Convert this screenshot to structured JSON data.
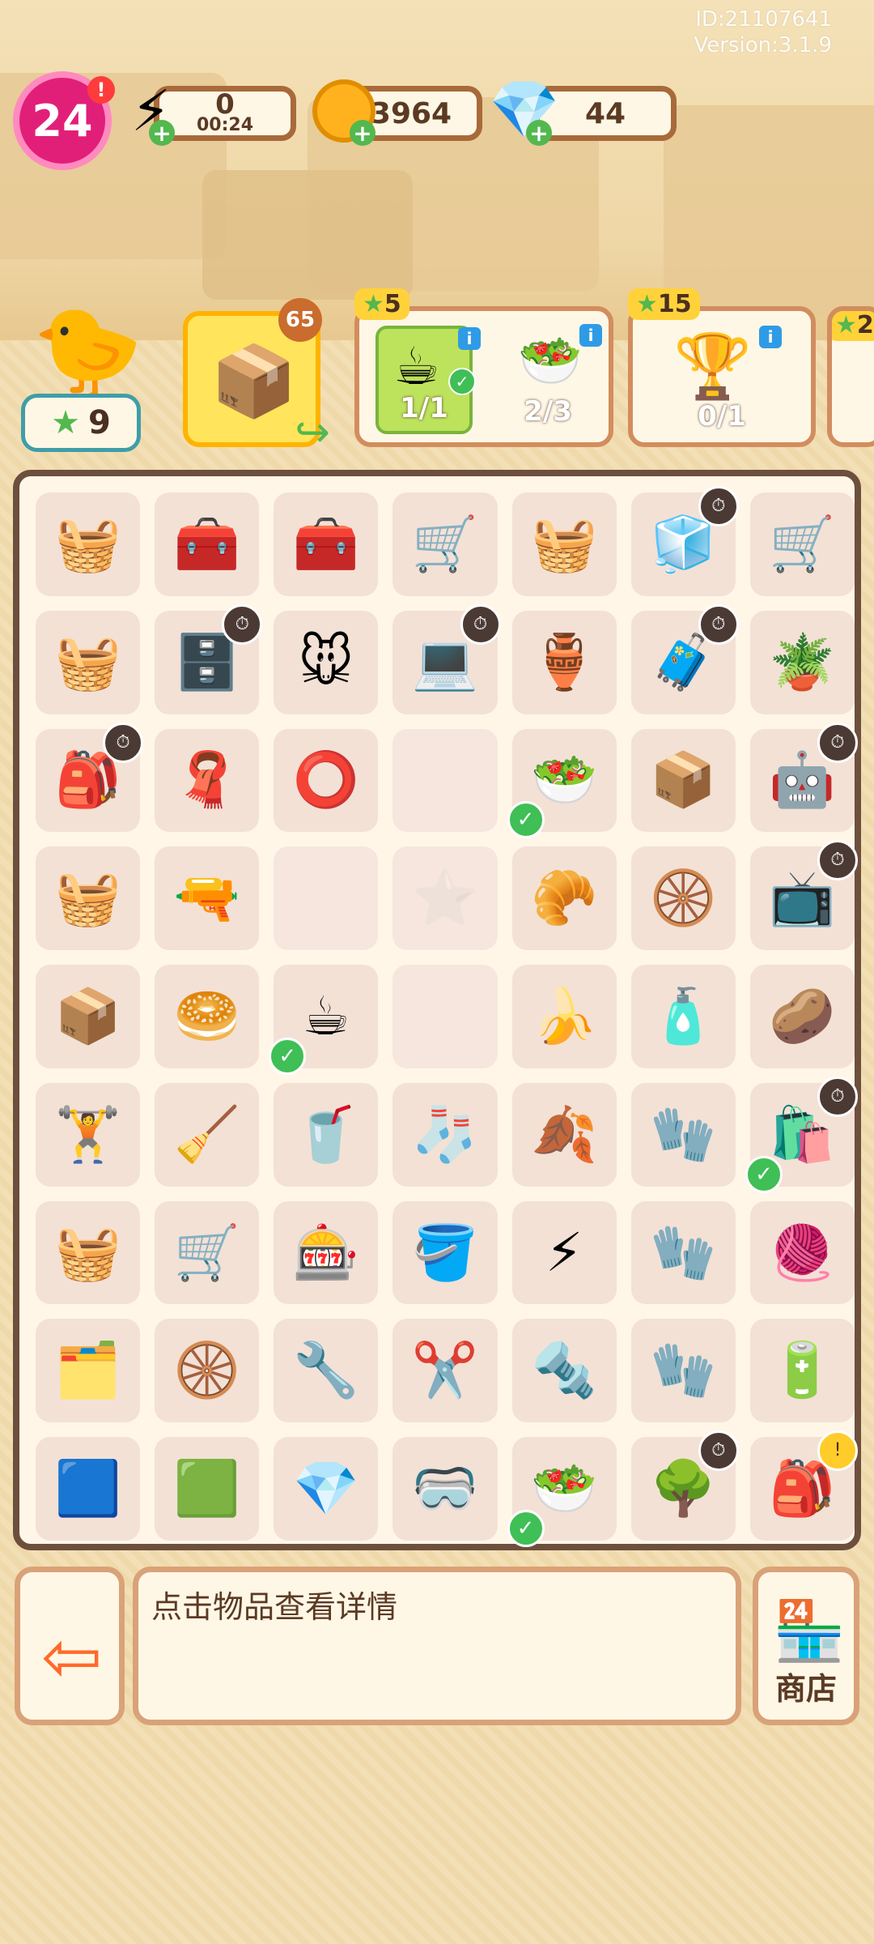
{
  "version": {
    "id": "ID:21107641",
    "version": "Version:3.1.9"
  },
  "hud": {
    "level": "24",
    "alert": "!",
    "energy": {
      "value": "0",
      "timer": "00:24",
      "plus": "+"
    },
    "coins": {
      "value": "3964",
      "plus": "+"
    },
    "gems": {
      "value": "44",
      "plus": "+"
    }
  },
  "quest_bar": {
    "stars": "9",
    "featured": {
      "count": "65"
    },
    "quests": [
      {
        "stars": "5",
        "items": [
          {
            "icon": "hot-chocolate-icon",
            "progress": "1/1",
            "done": true
          },
          {
            "icon": "salad-icon",
            "progress": "2/3",
            "done": false
          }
        ]
      },
      {
        "stars": "15",
        "items": [
          {
            "icon": "trophy-icon",
            "progress": "0/1",
            "done": false
          }
        ]
      },
      {
        "stars": "2"
      }
    ]
  },
  "board": {
    "rows": [
      [
        {
          "e": "🧺",
          "name": "blue-cart-tools"
        },
        {
          "e": "🧰",
          "name": "green-toolbox"
        },
        {
          "e": "🧰",
          "name": "green-chest"
        },
        {
          "e": "🛒",
          "name": "shopping-cart"
        },
        {
          "e": "🧺",
          "name": "yellow-basket"
        },
        {
          "e": "🧊",
          "name": "pink-fridge",
          "timer": true
        },
        {
          "e": "🛒",
          "name": "loaded-cart"
        }
      ],
      [
        {
          "e": "🧺",
          "name": "basket-dumbbells"
        },
        {
          "e": "🗄️",
          "name": "wooden-cabinet",
          "timer": true
        },
        {
          "e": "🐭",
          "name": "mouse-statue"
        },
        {
          "e": "💻",
          "name": "laptop",
          "timer": true
        },
        {
          "e": "🏺",
          "name": "trophy-silhouette"
        },
        {
          "e": "🧳",
          "name": "pink-suitcase",
          "timer": true
        },
        {
          "e": "🪴",
          "name": "seed-pot"
        }
      ],
      [
        {
          "e": "🎒",
          "name": "bags-pile",
          "timer": true
        },
        {
          "e": "🧣",
          "name": "neck-pillow"
        },
        {
          "e": "⭕",
          "name": "cable-ring"
        },
        {
          "e": "",
          "name": "empty",
          "empty": true
        },
        {
          "e": "🥗",
          "name": "salad",
          "check": true
        },
        {
          "e": "📦",
          "name": "open-box"
        },
        {
          "e": "🤖",
          "name": "robot-vacuum",
          "timer": true
        }
      ],
      [
        {
          "e": "🧺",
          "name": "flower-basket"
        },
        {
          "e": "🔫",
          "name": "massage-gun"
        },
        {
          "e": "",
          "name": "empty",
          "empty": true
        },
        {
          "e": "⭐",
          "name": "star-slot",
          "empty": true
        },
        {
          "e": "🥐",
          "name": "croissant"
        },
        {
          "e": "🛞",
          "name": "wheel"
        },
        {
          "e": "📺",
          "name": "tv",
          "timer": true
        }
      ],
      [
        {
          "e": "📦",
          "name": "box-stack"
        },
        {
          "e": "🥯",
          "name": "bagel"
        },
        {
          "e": "☕",
          "name": "hot-chocolate",
          "check": true
        },
        {
          "e": "",
          "name": "empty",
          "empty": true
        },
        {
          "e": "🍌",
          "name": "banana-peel"
        },
        {
          "e": "🧴",
          "name": "drink-bottle"
        },
        {
          "e": "🥔",
          "name": "potato"
        }
      ],
      [
        {
          "e": "🏋️",
          "name": "exercise-bench"
        },
        {
          "e": "🧹",
          "name": "junk-bin"
        },
        {
          "e": "🥤",
          "name": "cup"
        },
        {
          "e": "🧦",
          "name": "sock"
        },
        {
          "e": "🍂",
          "name": "bread-roll"
        },
        {
          "e": "🧤",
          "name": "green-gloves"
        },
        {
          "e": "🛍️",
          "name": "trash-bag",
          "timer": true,
          "check": true
        }
      ],
      [
        {
          "e": "🧺",
          "name": "yellow-crate"
        },
        {
          "e": "🛒",
          "name": "small-cart"
        },
        {
          "e": "🎰",
          "name": "orange-machine"
        },
        {
          "e": "🪣",
          "name": "ice-bucket"
        },
        {
          "e": "⚡",
          "name": "energy-orb"
        },
        {
          "e": "🧤",
          "name": "green-gloves-2"
        },
        {
          "e": "🧶",
          "name": "coil"
        }
      ],
      [
        {
          "e": "🗂️",
          "name": "tray"
        },
        {
          "e": "🛞",
          "name": "wheels"
        },
        {
          "e": "🔧",
          "name": "pipe-wrench"
        },
        {
          "e": "✂️",
          "name": "pliers"
        },
        {
          "e": "🔩",
          "name": "adjustable-wrench"
        },
        {
          "e": "🧤",
          "name": "green-gloves-3"
        },
        {
          "e": "🔋",
          "name": "capacitor"
        }
      ],
      [
        {
          "e": "🟦",
          "name": "circuit-board"
        },
        {
          "e": "🟩",
          "name": "green-case"
        },
        {
          "e": "💎",
          "name": "dumbbells"
        },
        {
          "e": "🥽",
          "name": "vr-headset"
        },
        {
          "e": "🥗",
          "name": "salad-2",
          "check": true
        },
        {
          "e": "🌳",
          "name": "potted-tree",
          "timer": true
        },
        {
          "e": "🎒",
          "name": "pink-backpack",
          "alert": true
        }
      ]
    ]
  },
  "footer": {
    "hint": "点击物品查看详情",
    "shop_label": "商店"
  }
}
